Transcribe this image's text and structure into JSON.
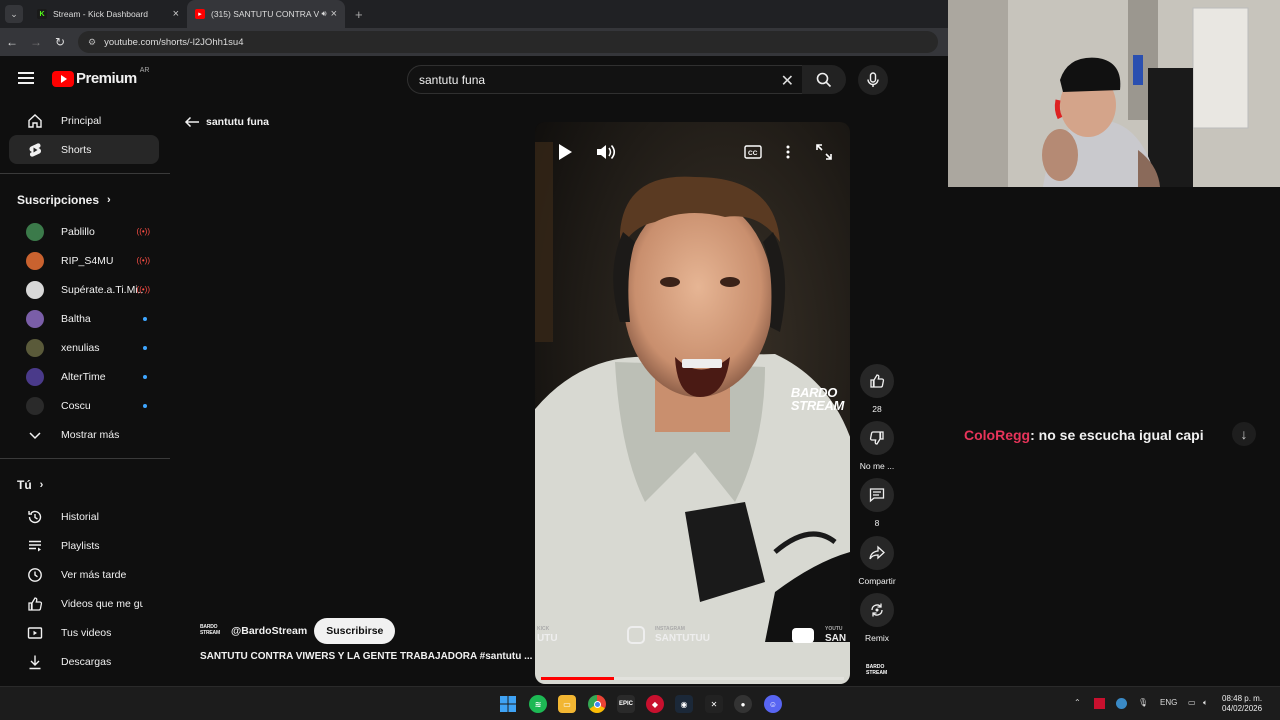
{
  "browser": {
    "tabs": [
      {
        "title": "Stream - Kick Dashboard",
        "active": false
      },
      {
        "title": "(315) SANTUTU CONTRA V",
        "active": true
      }
    ],
    "url": "youtube.com/shorts/-l2JOhh1su4"
  },
  "youtube": {
    "logo_text": "Premium",
    "country": "AR",
    "search_value": "santutu funa"
  },
  "sidebar": {
    "nav": [
      {
        "label": "Principal",
        "icon": "home-icon"
      },
      {
        "label": "Shorts",
        "icon": "shorts-icon",
        "active": true
      }
    ],
    "subscriptions_title": "Suscripciones",
    "subscriptions": [
      {
        "label": "Pablillo",
        "status": "live",
        "color": "#3b7a4a"
      },
      {
        "label": "RIP_S4MU",
        "status": "live",
        "color": "#c9622f"
      },
      {
        "label": "Supérate.a.Ti.Mi...",
        "status": "live",
        "color": "#d8d8d8"
      },
      {
        "label": "Baltha",
        "status": "new",
        "color": "#7a5ea8"
      },
      {
        "label": "xenulias",
        "status": "new",
        "color": "#5a5a3a"
      },
      {
        "label": "AlterTime",
        "status": "new",
        "color": "#4a3a8a"
      },
      {
        "label": "Coscu",
        "status": "new",
        "color": "#2a2a2a"
      }
    ],
    "show_more": "Mostrar más",
    "you_title": "Tú",
    "you_items": [
      {
        "label": "Historial",
        "icon": "history-icon"
      },
      {
        "label": "Playlists",
        "icon": "playlists-icon"
      },
      {
        "label": "Ver más tarde",
        "icon": "watch-later-icon"
      },
      {
        "label": "Videos que me gus...",
        "icon": "liked-videos-icon"
      },
      {
        "label": "Tus videos",
        "icon": "your-videos-icon"
      },
      {
        "label": "Descargas",
        "icon": "downloads-icon"
      }
    ]
  },
  "shorts": {
    "back_label": "santutu funa",
    "channel": "@BardoStream",
    "subscribe_label": "Suscribirse",
    "title": "SANTUTU CONTRA VIWERS Y LA GENTE TRABAJADORA #santutu ...",
    "progress": 0.24,
    "watermark": [
      "BARDO",
      "STREAM"
    ],
    "overlay_left": "UTU",
    "overlay_ig_label": "INSTAGRAM",
    "overlay_ig_handle": "SANTUTUU",
    "overlay_yt_label": "YOUTU",
    "overlay_yt_handle": "SAN",
    "overlay_kick_label": "KICK",
    "channel_logo": [
      "BARDO",
      "STREAM"
    ],
    "actions": [
      {
        "label": "28",
        "icon": "like-icon"
      },
      {
        "label": "No me ...",
        "icon": "dislike-icon"
      },
      {
        "label": "8",
        "icon": "comment-icon"
      },
      {
        "label": "Compartir",
        "icon": "share-icon"
      },
      {
        "label": "Remix",
        "icon": "remix-icon"
      }
    ]
  },
  "chat": {
    "user": "ColoRegg",
    "message": ": no se escucha igual capi"
  },
  "taskbar": {
    "lang": "ENG",
    "time": "08:48 p. m.",
    "date": "04/02/2026"
  },
  "colors": {
    "accent_red": "#ff0000",
    "chat_user": "#e8345a",
    "new_dot": "#3ea6ff"
  }
}
